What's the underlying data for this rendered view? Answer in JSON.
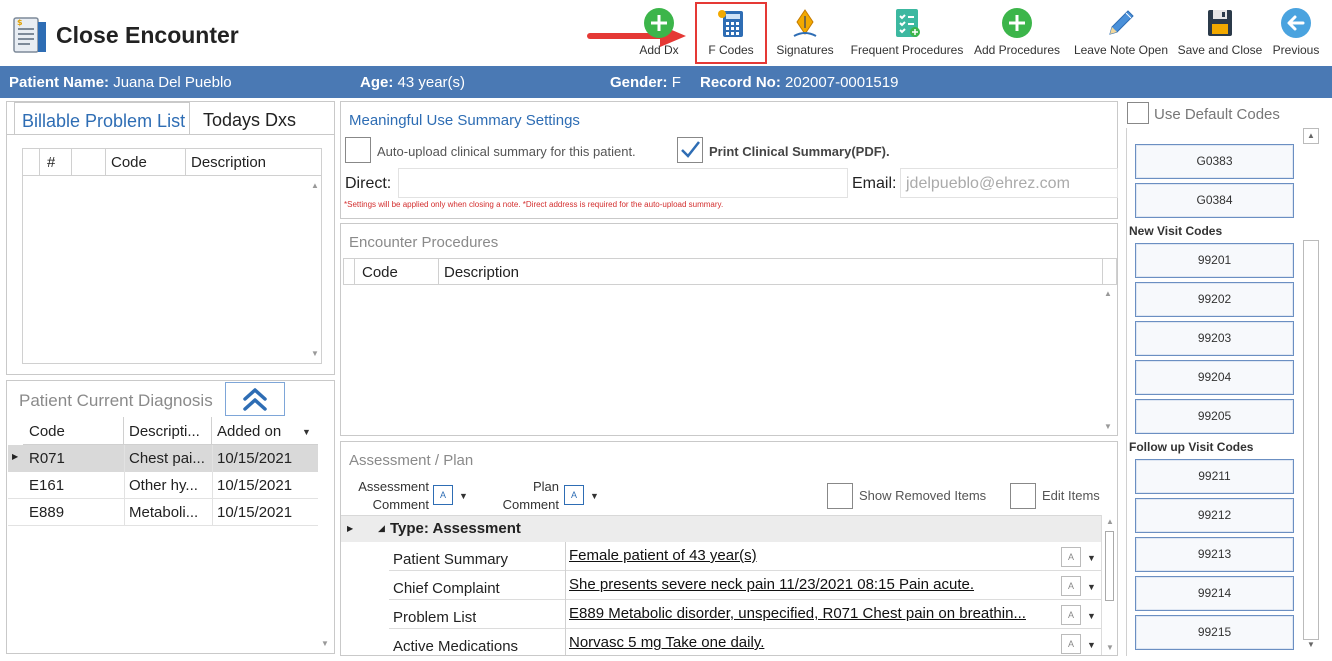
{
  "header": {
    "title": "Close Encounter",
    "toolbar": {
      "add_dx": "Add Dx",
      "f_codes": "F Codes",
      "signatures": "Signatures",
      "frequent_procedures": "Frequent Procedures",
      "add_procedures": "Add Procedures",
      "leave_note_open": "Leave Note Open",
      "save_and_close": "Save and Close",
      "previous": "Previous"
    }
  },
  "patient": {
    "name_label": "Patient Name:",
    "name": "Juana Del Pueblo",
    "age_label": "Age:",
    "age": "43 year(s)",
    "gender_label": "Gender:",
    "gender": "F",
    "record_label": "Record No:",
    "record": "202007-0001519"
  },
  "left": {
    "tabs": [
      "Billable Problem List",
      "Todays Dxs"
    ],
    "grid_headers": [
      "#",
      "Code",
      "Description"
    ],
    "diagnosis_title": "Patient Current Diagnosis",
    "diagnosis_headers": [
      "Code",
      "Descripti...",
      "Added on"
    ],
    "diagnosis_rows": [
      {
        "code": "R071",
        "description": "Chest pai...",
        "added_on": "10/15/2021"
      },
      {
        "code": "E161",
        "description": "Other hy...",
        "added_on": "10/15/2021"
      },
      {
        "code": "E889",
        "description": "Metaboli...",
        "added_on": "10/15/2021"
      }
    ]
  },
  "mu": {
    "title": "Meaningful Use Summary Settings",
    "auto_upload_label": "Auto-upload clinical summary for this patient.",
    "print_label": "Print Clinical Summary(PDF).",
    "direct_label": "Direct:",
    "email_label": "Email:",
    "email_value": "jdelpueblo@ehrez.com",
    "note": "*Settings will be applied only when closing a note.   *Direct address is required for the auto-upload summary."
  },
  "procedures": {
    "title": "Encounter Procedures",
    "headers": [
      "Code",
      "Description"
    ]
  },
  "assessment": {
    "title": "Assessment / Plan",
    "assessment_comment": [
      "Assessment",
      "Comment"
    ],
    "plan_comment": [
      "Plan",
      "Comment"
    ],
    "show_removed": "Show Removed Items",
    "edit_items": "Edit Items",
    "group_label": "Type: Assessment",
    "rows": [
      {
        "label": "Patient Summary",
        "value": "Female patient of 43 year(s)"
      },
      {
        "label": "Chief Complaint",
        "value": " She presents severe neck pain 11/23/2021 08:15 Pain acute. "
      },
      {
        "label": "Problem List",
        "value": "E889 Metabolic disorder, unspecified, R071 Chest pain on breathin..."
      },
      {
        "label": "Active Medications",
        "value": "Norvasc 5 mg Take one daily. "
      }
    ]
  },
  "codes": {
    "use_default": "Use Default Codes",
    "top_codes": [
      "G0383",
      "G0384"
    ],
    "new_visit_title": "New Visit Codes",
    "new_visit": [
      "99201",
      "99202",
      "99203",
      "99204",
      "99205"
    ],
    "follow_up_title": "Follow up Visit Codes",
    "follow_up": [
      "99211",
      "99212",
      "99213",
      "99214",
      "99215"
    ]
  },
  "colors": {
    "patient_bar": "#4a79b4",
    "accent_blue": "#2e6db4",
    "highlight_red": "#e53935",
    "green_icon": "#3cb54a"
  }
}
